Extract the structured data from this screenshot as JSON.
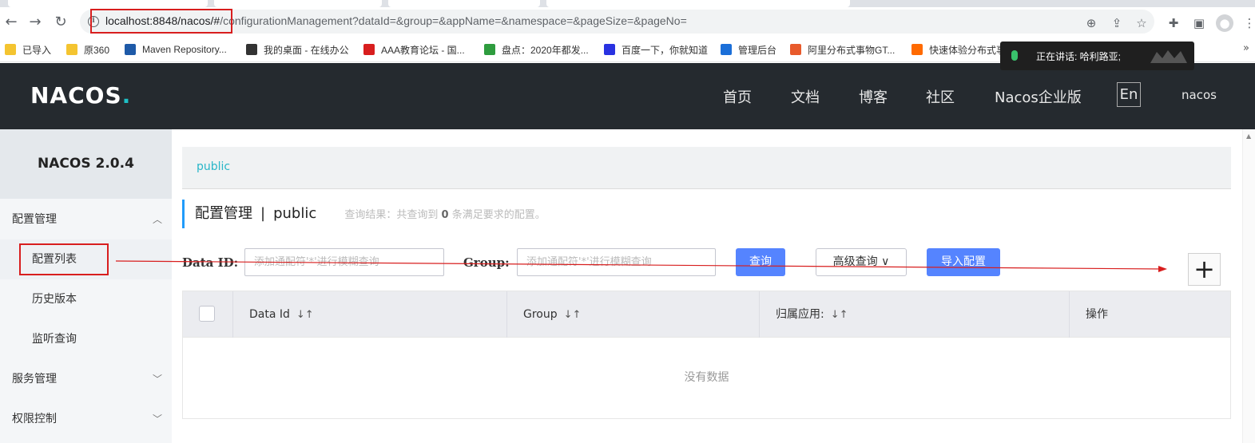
{
  "browser": {
    "url_host": "localhost:8848/nacos/#",
    "url_rest": "/configurationManagement?dataId=&group=&appName=&namespace=&pageSize=&pageNo=",
    "bookmarks": [
      {
        "label": "已导入",
        "icon": "folder-icon",
        "color": "#f4c430"
      },
      {
        "label": "原360",
        "icon": "folder-icon",
        "color": "#f4c430"
      },
      {
        "label": "Maven Repository...",
        "icon": "maven-icon",
        "color": "#1e5aa8"
      },
      {
        "label": "我的桌面 - 在线办公",
        "icon": "desktop-icon",
        "color": "#333333"
      },
      {
        "label": "AAA教育论坛 - 国...",
        "icon": "aaa-icon",
        "color": "#d81e1e"
      },
      {
        "label": "盘点：2020年都发...",
        "icon": "chart-icon",
        "color": "#2e9c3e"
      },
      {
        "label": "百度一下，你就知道",
        "icon": "baidu-icon",
        "color": "#2932e1"
      },
      {
        "label": "管理后台",
        "icon": "admin-icon",
        "color": "#1b6fd8"
      },
      {
        "label": "阿里分布式事物GT...",
        "icon": "c-icon",
        "color": "#e85a2b"
      },
      {
        "label": "快速体验分布式事",
        "icon": "bracket-icon",
        "color": "#ff6a00"
      }
    ],
    "speaking_text": "正在讲话: 哈利路亚;"
  },
  "header": {
    "logo": "NACOS",
    "logo_dot": ".",
    "nav": [
      "首页",
      "文档",
      "博客",
      "社区",
      "Nacos企业版"
    ],
    "lang": "En",
    "user": "nacos"
  },
  "sidebar": {
    "title": "NACOS 2.0.4",
    "groups": [
      {
        "label": "配置管理",
        "expanded": true
      },
      {
        "label": "服务管理",
        "expanded": false
      },
      {
        "label": "权限控制",
        "expanded": false
      }
    ],
    "config_items": [
      "配置列表",
      "历史版本",
      "监听查询"
    ]
  },
  "main": {
    "namespace": "public",
    "title": "配置管理",
    "title_sep": "|",
    "title_ns": "public",
    "result_prefix": "查询结果：共查询到",
    "result_count": "0",
    "result_suffix": "条满足要求的配置。",
    "dataid_label": "Data ID:",
    "dataid_placeholder": "添加通配符'*'进行模糊查询",
    "group_label": "Group:",
    "group_placeholder": "添加通配符'*'进行模糊查询",
    "query_button": "查询",
    "advanced_button": "高级查询",
    "import_button": "导入配置",
    "add_button": "+",
    "table": {
      "columns": [
        "Data Id",
        "Group",
        "归属应用:",
        "操作"
      ],
      "empty_text": "没有数据"
    }
  },
  "colors": {
    "header_bg": "#252a2f",
    "primary": "#5584ff",
    "accent": "#209bfa",
    "annotation_red": "#d81e1e"
  }
}
